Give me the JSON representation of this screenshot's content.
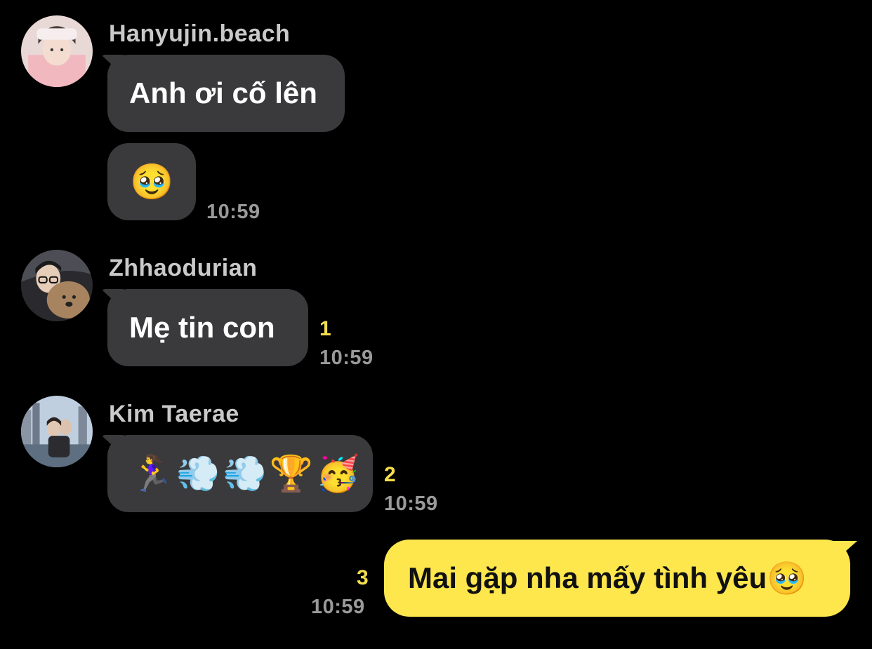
{
  "colors": {
    "background": "#000000",
    "incoming_bubble": "#3a3a3c",
    "outgoing_bubble": "#fde74d",
    "unread_count": "#f5df4d",
    "timestamp": "#9a9a9a",
    "sender_name": "#c9c9c9"
  },
  "messages": [
    {
      "sender": "Hanyujin.beach",
      "bubbles": [
        {
          "text": "Anh ơi cố lên"
        },
        {
          "text": "🥹"
        }
      ],
      "time": "10:59",
      "unread": ""
    },
    {
      "sender": "Zhhaodurian",
      "bubbles": [
        {
          "text": "Mẹ tin con"
        }
      ],
      "time": "10:59",
      "unread": "1"
    },
    {
      "sender": "Kim Taerae",
      "bubbles": [
        {
          "text": "🏃‍♀️💨💨🏆🥳"
        }
      ],
      "time": "10:59",
      "unread": "2"
    }
  ],
  "outgoing": {
    "text": "Mai gặp nha mấy tình yêu",
    "emoji": "🥹",
    "time": "10:59",
    "unread": "3"
  }
}
